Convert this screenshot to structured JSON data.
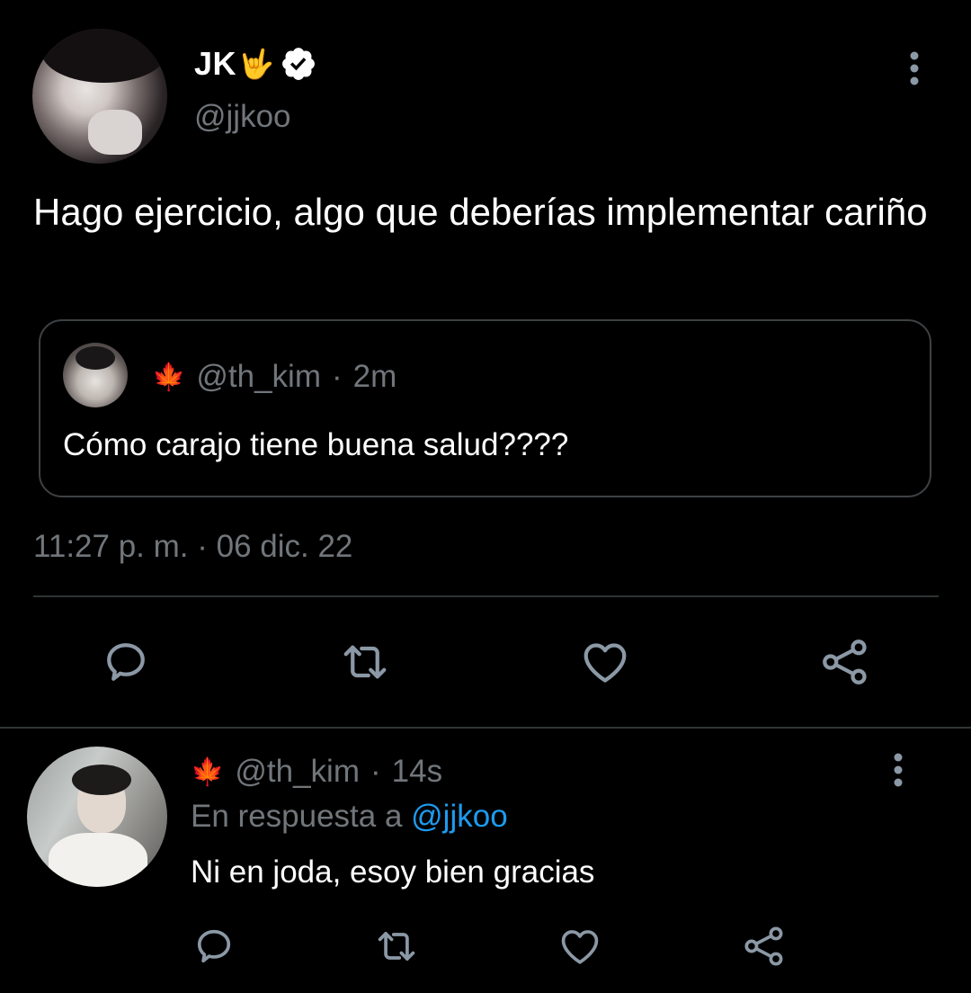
{
  "main_tweet": {
    "display_name": "JK",
    "name_emoji": "🤟",
    "verified": true,
    "handle": "@jjkoo",
    "text": "Hago ejercicio, algo que deberías implementar cariño",
    "quoted": {
      "emoji": "🍁",
      "handle": "@th_kim",
      "separator": "·",
      "time": "2m",
      "text": "Cómo carajo tiene buena salud????"
    },
    "timestamp": "11:27 p. m. · 06 dic. 22",
    "actions": [
      "reply-icon",
      "retweet-icon",
      "like-icon",
      "share-icon"
    ]
  },
  "reply_tweet": {
    "emoji": "🍁",
    "handle": "@th_kim",
    "separator": "·",
    "time": "14s",
    "reply_prefix": "En respuesta a ",
    "reply_to": "@jjkoo",
    "text": "Ni en joda, esoy bien gracias",
    "actions": [
      "reply-icon",
      "retweet-icon",
      "like-icon",
      "share-icon"
    ]
  },
  "colors": {
    "background": "#000000",
    "text_primary": "#ffffff",
    "text_secondary": "#71767b",
    "link": "#1d9bf0",
    "border": "#2f3336",
    "icon": "#8b98a5"
  }
}
